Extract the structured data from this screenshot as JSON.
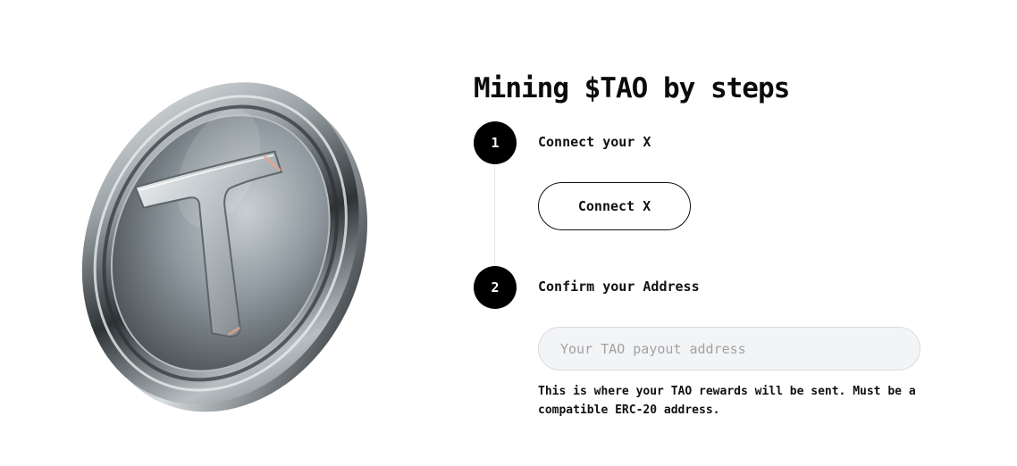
{
  "page": {
    "title": "Mining $TAO by steps"
  },
  "illustration": {
    "icon": "tao-coin-icon"
  },
  "steps": [
    {
      "number": "1",
      "label": "Connect your X",
      "button_label": "Connect X"
    },
    {
      "number": "2",
      "label": "Confirm your Address",
      "input_value": "",
      "input_placeholder": "Your TAO payout address",
      "help_text": "This is where your TAO rewards will be sent. Must be a compatible ERC-20 address."
    }
  ],
  "colors": {
    "step_circle": "#000000",
    "input_background": "#f3f4f6",
    "text": "#111111"
  }
}
